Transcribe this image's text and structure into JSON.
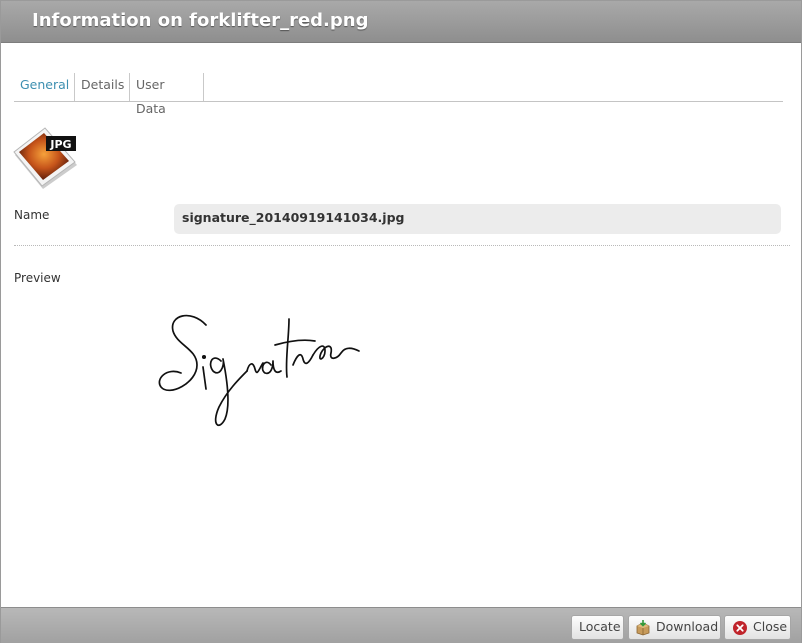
{
  "dialog": {
    "title": "Information on forklifter_red.png"
  },
  "tabs": [
    {
      "label": "General",
      "active": true
    },
    {
      "label": "Details",
      "active": false
    },
    {
      "label": "User Data",
      "active": false
    }
  ],
  "file_icon": {
    "icon": "jpg-file-icon",
    "badge_text": "JPG"
  },
  "name": {
    "label": "Name",
    "value": "signature_20140919141034.jpg"
  },
  "preview": {
    "label": "Preview",
    "image": "handwritten-signature-image"
  },
  "footer": {
    "locate_label": "Locate",
    "download_label": "Download",
    "close_label": "Close"
  },
  "colors": {
    "titlebar": "#9b9b9b",
    "active_tab": "#3d8fb0",
    "close_icon": "#c0242b"
  }
}
